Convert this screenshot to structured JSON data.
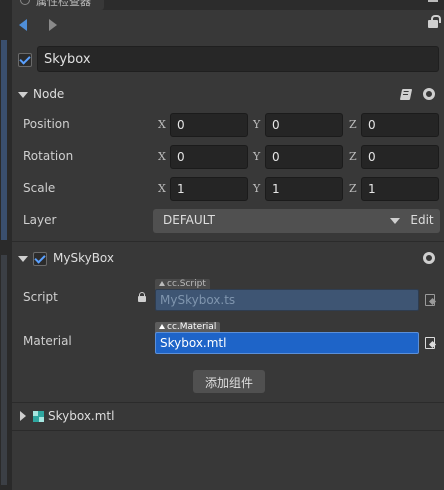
{
  "window": {
    "tab_title": "属性检查器"
  },
  "node": {
    "name": "Skybox",
    "section_title": "Node",
    "properties": {
      "position": {
        "label": "Position",
        "x": "0",
        "y": "0",
        "z": "0"
      },
      "rotation": {
        "label": "Rotation",
        "x": "0",
        "y": "0",
        "z": "0"
      },
      "scale": {
        "label": "Scale",
        "x": "1",
        "y": "1",
        "z": "1"
      },
      "layer": {
        "label": "Layer",
        "value": "DEFAULT",
        "edit_label": "Edit"
      }
    },
    "axis_labels": {
      "x": "X",
      "y": "Y",
      "z": "Z"
    }
  },
  "component": {
    "title": "MySkyBox",
    "script": {
      "label": "Script",
      "tag": "cc.Script",
      "value": "MySkybox.ts"
    },
    "material": {
      "label": "Material",
      "tag": "cc.Material",
      "value": "Skybox.mtl"
    }
  },
  "add_component_label": "添加组件",
  "asset_section": {
    "title": "Skybox.mtl"
  },
  "colors": {
    "accent": "#4f8ed8",
    "selected_field": "#1e64c8",
    "panel_bg": "#383838"
  }
}
